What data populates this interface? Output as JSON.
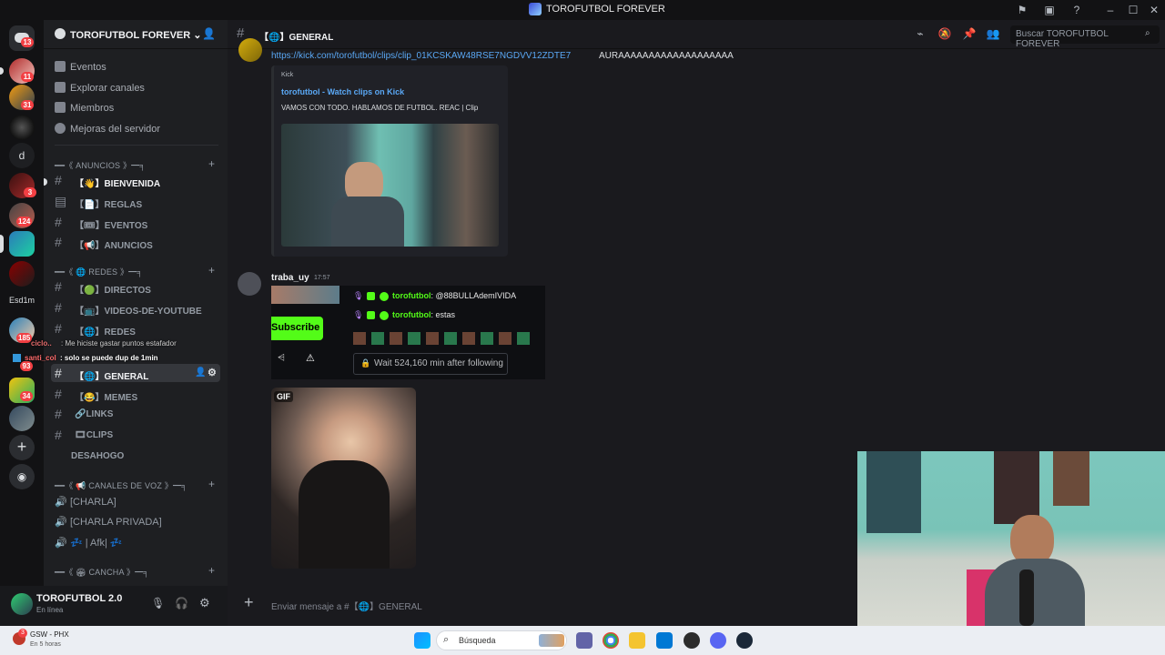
{
  "window": {
    "title": "TOROFUTBOL FOREVER"
  },
  "rail": {
    "servers": [
      {
        "badge": "13"
      },
      {
        "badge": "11"
      },
      {
        "badge": "31"
      },
      {
        "badge": ""
      },
      {
        "label": "d"
      },
      {
        "badge": "3"
      },
      {
        "badge": "124"
      },
      {
        "badge": ""
      },
      {
        "badge": "",
        "label": "Esd1m"
      },
      {
        "badge": "185"
      },
      {
        "badge": "93"
      },
      {
        "badge": "34"
      }
    ]
  },
  "server": {
    "name": "TOROFUTBOL FOREVER",
    "menu": [
      "Eventos",
      "Explorar canales",
      "Miembros",
      "Mejoras del servidor"
    ]
  },
  "categories": {
    "anuncios": "━━《 ANUNCIOS 》━╕",
    "redes": "━━《 🌐 REDES 》━╕",
    "voz": "━━《 📢 CANALES DE VOZ 》━╕",
    "cancha": "━━《 🏟 CANCHA 》━╕"
  },
  "channels": {
    "bienvenida": "【👋】BIENVENIDA",
    "reglas": "【📄】REGLAS",
    "eventos": "【🎟】EVENTOS",
    "anuncios": "【📢】ANUNCIOS",
    "directos": "【🟢】DIRECTOS",
    "videos": "【📺】VIDEOS-DE-YOUTUBE",
    "redes": "【🌐】REDES",
    "general": "【🌐】GENERAL",
    "memes": "【😂】MEMES",
    "links": "🔗LINKS",
    "clips": "🎞CLIPS",
    "desahogo": "DESAHOGO"
  },
  "voice": {
    "charla": "[CHARLA]",
    "charla_privada": "[CHARLA PRIVADA]",
    "afk": "💤 | Afk| 💤"
  },
  "user": {
    "name": "TOROFUTBOL 2.0",
    "status": "En línea"
  },
  "chat": {
    "channel_header": "【🌐】GENERAL",
    "search_placeholder": "Buscar TOROFUTBOL FOREVER",
    "message1": {
      "link": "https://kick.com/torofutbol/clips/clip_01KCSKAW48RSE7NGDVV12ZDTE7",
      "text": "AURAAAAAAAAAAAAAAAAAAA",
      "embed_provider": "Kick",
      "embed_title": "torofutbol - Watch clips on Kick",
      "embed_desc": "VAMOS CON TODO. HABLAMOS DE FUTBOL. REAC | Clip"
    },
    "message2": {
      "author": "traba_uy",
      "time": "17:57",
      "subscribe": "Subscribe",
      "kick_user": "torofutbol",
      "kick_line1": ": @88BULLAdemIVIDA",
      "kick_line2": ": estas",
      "wait": "Wait 524,160 min after following",
      "gif_tag": "GIF"
    },
    "composer_placeholder": "Enviar mensaje a #【🌐】GENERAL"
  },
  "stream_overlay": {
    "line1_user": "ciclo..",
    "line1": ": Me hiciste gastar puntos estafador",
    "line2_user": "santi_col",
    "line2": ": solo se puede dup de 1min"
  },
  "taskbar": {
    "weather_title": "GSW - PHX",
    "weather_sub": "En 5 horas",
    "weather_badge": "3",
    "search": "Búsqueda"
  },
  "colors": {
    "accent": "#5865f2",
    "kick": "#53fc18",
    "link": "#5aa8f5",
    "badge": "#f23f43"
  }
}
